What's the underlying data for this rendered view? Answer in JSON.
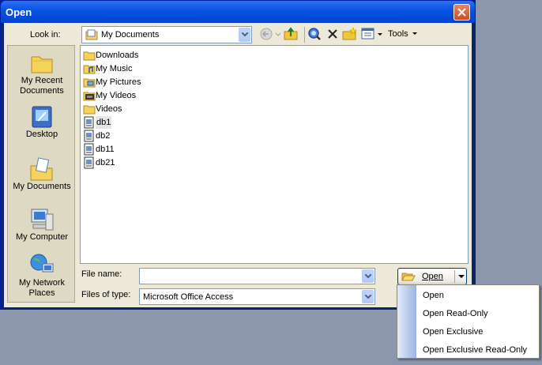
{
  "window": {
    "title": "Open"
  },
  "toolbar": {
    "look_in_label": "Look in:",
    "look_in_value": "My Documents",
    "tools_label": "Tools"
  },
  "places": [
    {
      "label": "My Recent Documents",
      "icon": "recent-documents-icon"
    },
    {
      "label": "Desktop",
      "icon": "desktop-icon"
    },
    {
      "label": "My Documents",
      "icon": "my-documents-icon"
    },
    {
      "label": "My Computer",
      "icon": "my-computer-icon"
    },
    {
      "label": "My Network Places",
      "icon": "network-places-icon"
    }
  ],
  "files": [
    {
      "name": "Downloads",
      "icon": "folder-icon"
    },
    {
      "name": "My Music",
      "icon": "music-folder-icon"
    },
    {
      "name": "My Pictures",
      "icon": "pictures-folder-icon"
    },
    {
      "name": "My Videos",
      "icon": "videos-folder-icon"
    },
    {
      "name": "Videos",
      "icon": "folder-icon"
    },
    {
      "name": "db1",
      "icon": "access-database-icon"
    },
    {
      "name": "db2",
      "icon": "access-database-icon"
    },
    {
      "name": "db11",
      "icon": "access-database-icon"
    },
    {
      "name": "db21",
      "icon": "access-database-icon"
    }
  ],
  "form": {
    "file_name_label": "File name:",
    "file_name_value": "",
    "files_of_type_label": "Files of type:",
    "files_of_type_value": "Microsoft Office Access"
  },
  "open_button": {
    "label": "Open"
  },
  "open_menu": {
    "items": [
      "Open",
      "Open Read-Only",
      "Open Exclusive",
      "Open Exclusive Read-Only"
    ]
  },
  "colors": {
    "title_bar": "#0a55e4",
    "dialog_face": "#ece9d8",
    "desktop_background": "#8c96ac"
  }
}
